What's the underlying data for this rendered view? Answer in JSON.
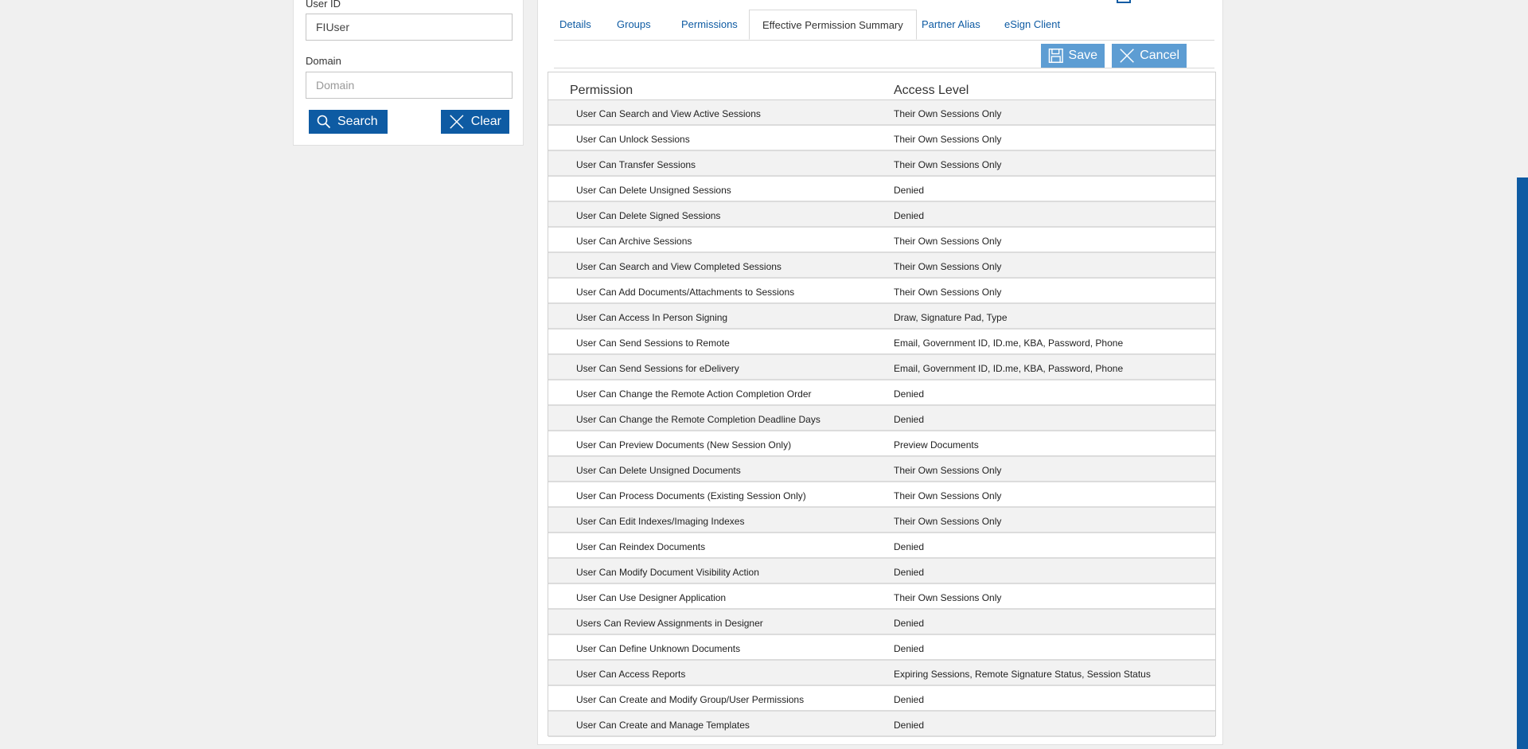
{
  "search": {
    "user_id_label": "User ID",
    "user_id_value": "FIUser",
    "domain_label": "Domain",
    "domain_placeholder": "Domain",
    "search_button": "Search",
    "clear_button": "Clear"
  },
  "tabs": [
    {
      "label": "Details"
    },
    {
      "label": "Groups"
    },
    {
      "label": "Permissions"
    },
    {
      "label": "Effective Permission Summary"
    },
    {
      "label": "Partner Alias"
    },
    {
      "label": "eSign Client"
    }
  ],
  "actions": {
    "save": "Save",
    "cancel": "Cancel"
  },
  "table": {
    "headers": {
      "permission": "Permission",
      "access": "Access Level"
    },
    "rows": [
      {
        "permission": "User Can Search and View Active Sessions",
        "access": "Their Own Sessions Only"
      },
      {
        "permission": "User Can Unlock Sessions",
        "access": "Their Own Sessions Only"
      },
      {
        "permission": "User Can Transfer Sessions",
        "access": "Their Own Sessions Only"
      },
      {
        "permission": "User Can Delete Unsigned Sessions",
        "access": "Denied"
      },
      {
        "permission": "User Can Delete Signed Sessions",
        "access": "Denied"
      },
      {
        "permission": "User Can Archive Sessions",
        "access": "Their Own Sessions Only"
      },
      {
        "permission": "User Can Search and View Completed Sessions",
        "access": "Their Own Sessions Only"
      },
      {
        "permission": "User Can Add Documents/Attachments to Sessions",
        "access": "Their Own Sessions Only"
      },
      {
        "permission": "User Can Access In Person Signing",
        "access": "Draw, Signature Pad, Type"
      },
      {
        "permission": "User Can Send Sessions to Remote",
        "access": "Email, Government ID, ID.me, KBA, Password, Phone"
      },
      {
        "permission": "User Can Send Sessions for eDelivery",
        "access": "Email, Government ID, ID.me, KBA, Password, Phone"
      },
      {
        "permission": "User Can Change the Remote Action Completion Order",
        "access": "Denied"
      },
      {
        "permission": "User Can Change the Remote Completion Deadline Days",
        "access": "Denied"
      },
      {
        "permission": "User Can Preview Documents (New Session Only)",
        "access": "Preview Documents"
      },
      {
        "permission": "User Can Delete Unsigned Documents",
        "access": "Their Own Sessions Only"
      },
      {
        "permission": "User Can Process Documents (Existing Session Only)",
        "access": "Their Own Sessions Only"
      },
      {
        "permission": "User Can Edit Indexes/Imaging Indexes",
        "access": "Their Own Sessions Only"
      },
      {
        "permission": "User Can Reindex Documents",
        "access": "Denied"
      },
      {
        "permission": "User Can Modify Document Visibility Action",
        "access": "Denied"
      },
      {
        "permission": "User Can Use Designer Application",
        "access": "Their Own Sessions Only"
      },
      {
        "permission": "Users Can Review Assignments in Designer",
        "access": "Denied"
      },
      {
        "permission": "User Can Define Unknown Documents",
        "access": "Denied"
      },
      {
        "permission": "User Can Access Reports",
        "access": "Expiring Sessions, Remote Signature Status, Session Status"
      },
      {
        "permission": "User Can Create and Modify Group/User Permissions",
        "access": "Denied"
      },
      {
        "permission": "User Can Create and Manage Templates",
        "access": "Denied"
      }
    ]
  }
}
